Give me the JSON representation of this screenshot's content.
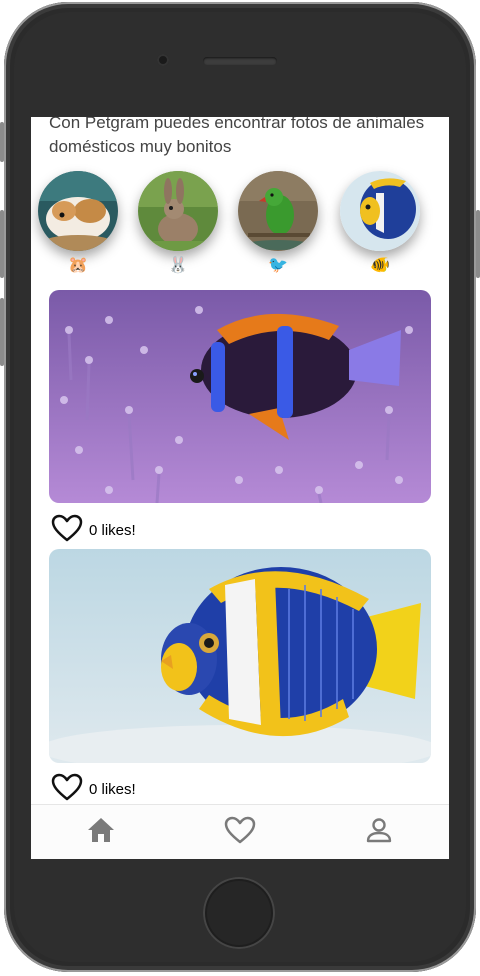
{
  "app": {
    "intro_text": "Con Petgram puedes encontrar fotos de animales domésticos muy bonitos"
  },
  "categories": [
    {
      "name": "hamster",
      "emoji": "🐹"
    },
    {
      "name": "rabbit",
      "emoji": "🐰"
    },
    {
      "name": "bird",
      "emoji": "🐦"
    },
    {
      "name": "fish",
      "emoji": "🐠"
    }
  ],
  "photos": [
    {
      "subject": "clownfish on anemone",
      "likes": "0 likes!"
    },
    {
      "subject": "blue and yellow angelfish",
      "likes": "0 likes!"
    }
  ],
  "navbar": {
    "items": [
      {
        "icon": "home-icon"
      },
      {
        "icon": "heart-icon"
      },
      {
        "icon": "user-icon"
      }
    ]
  },
  "colors": {
    "phone_body": "#2b2b2b",
    "icon_gray": "#888888",
    "text": "#444444"
  }
}
